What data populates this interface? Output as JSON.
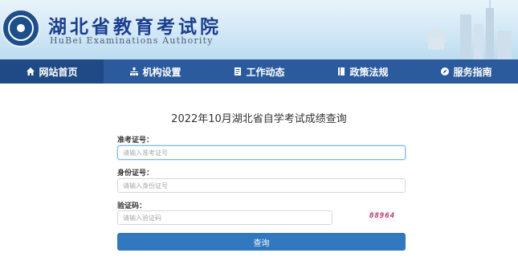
{
  "header": {
    "title_cn": "湖北省教育考试院",
    "title_en": "HuBei Examinations Authority"
  },
  "nav": {
    "items": [
      {
        "label": "网站首页",
        "icon": "home-icon"
      },
      {
        "label": "机构设置",
        "icon": "org-chart-icon"
      },
      {
        "label": "工作动态",
        "icon": "document-icon"
      },
      {
        "label": "政策法规",
        "icon": "book-icon"
      },
      {
        "label": "服务指南",
        "icon": "compass-icon"
      }
    ]
  },
  "form": {
    "title": "2022年10月湖北省自学考试成绩查询",
    "exam_id": {
      "label": "准考证号：",
      "placeholder": "请输入准考证号"
    },
    "id_card": {
      "label": "身份证号：",
      "placeholder": "请输入身份证号"
    },
    "captcha": {
      "label": "验证码：",
      "placeholder": "请输入验证码",
      "code": "08964"
    },
    "submit_label": "查询"
  },
  "colors": {
    "nav_bg": "#2b5a9d",
    "nav_active": "#1f4a86",
    "button": "#3278be",
    "title": "#1b3f8f"
  }
}
